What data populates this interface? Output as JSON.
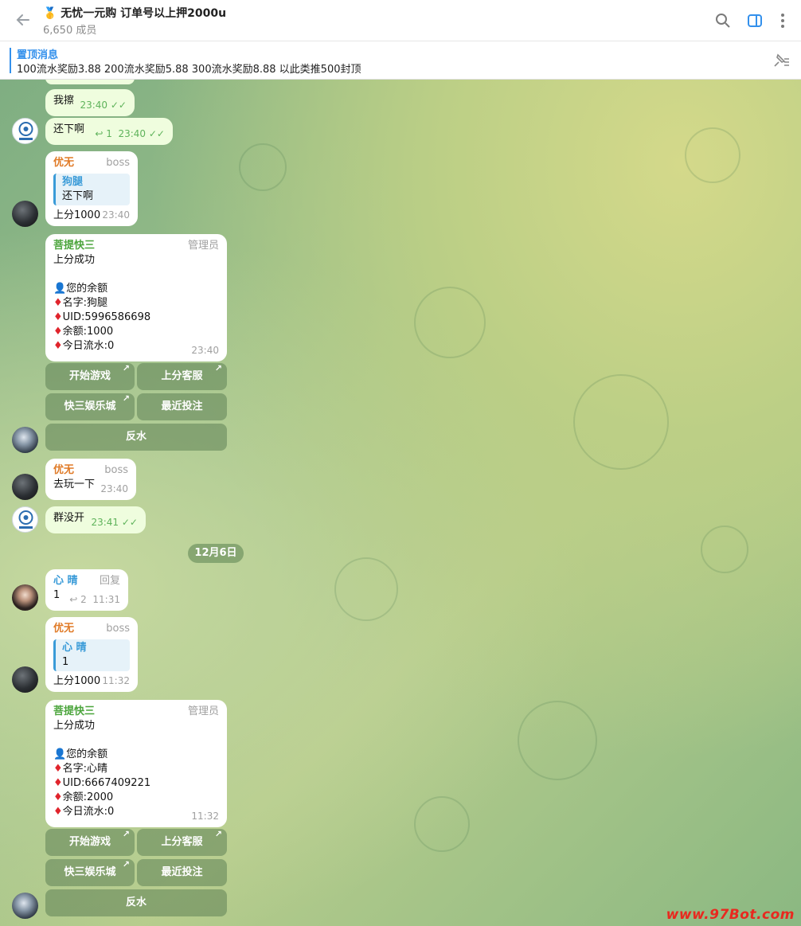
{
  "header": {
    "title": "🥇 无忧一元购 订单号以上押2000u",
    "members": "6,650 成员"
  },
  "pinned": {
    "label": "置顶消息",
    "text": "100流水奖励3.88 200流水奖励5.88 300流水奖励8.88 以此类推500封顶"
  },
  "messages": {
    "m1": {
      "text": "我擦",
      "time": "23:40"
    },
    "m2": {
      "text": "还下啊",
      "replies": "1",
      "time": "23:40"
    },
    "m3": {
      "sender": "优无",
      "role": "boss",
      "quote_name": "狗腿",
      "quote_text": "还下啊",
      "text": "上分1000",
      "time": "23:40"
    },
    "m4": {
      "sender": "菩提快三",
      "role": "管理员",
      "line1": "上分成功",
      "line2": "👤您的余额",
      "name": "名字:狗腿",
      "uid": "UID:5996586698",
      "balance": "余额:1000",
      "flow": "今日流水:0",
      "time": "23:40"
    },
    "m5": {
      "sender": "优无",
      "role": "boss",
      "text": "去玩一下",
      "time": "23:40"
    },
    "m6": {
      "text": "群没开",
      "time": "23:41"
    },
    "date": "12月6日",
    "m7": {
      "sender": "心 晴",
      "role": "回复",
      "text": "1",
      "replies": "2",
      "time": "11:31"
    },
    "m8": {
      "sender": "优无",
      "role": "boss",
      "quote_name": "心 晴",
      "quote_text": "1",
      "text": "上分1000",
      "time": "11:32"
    },
    "m9": {
      "sender": "菩提快三",
      "role": "管理员",
      "line1": "上分成功",
      "line2": "👤您的余额",
      "name": "名字:心晴",
      "uid": "UID:6667409221",
      "balance": "余额:2000",
      "flow": "今日流水:0",
      "time": "11:32"
    }
  },
  "keyboard": {
    "start_game": "开始游戏",
    "support": "上分客服",
    "casino": "快三娱乐城",
    "recent_bets": "最近投注",
    "rebate": "反水"
  },
  "diamond_glyph": "♦",
  "watermark": "www.97Bot.com",
  "colors": {
    "accent": "#3390ec",
    "sender_orange": "#e07b28",
    "sender_green": "#4ca53d",
    "sender_blue": "#3a9bd8"
  }
}
